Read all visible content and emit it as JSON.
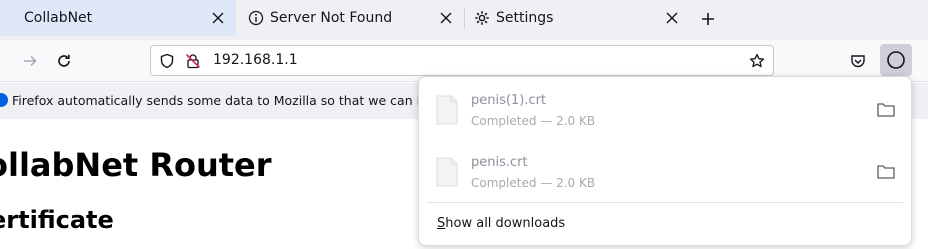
{
  "tabs": [
    {
      "label": "CollabNet",
      "active": true,
      "icon": "none"
    },
    {
      "label": "Server Not Found",
      "active": false,
      "icon": "info-icon"
    },
    {
      "label": "Settings",
      "active": false,
      "icon": "gear-icon"
    }
  ],
  "address_bar": {
    "url": "192.168.1.1"
  },
  "notification": {
    "text": "Firefox automatically sends some data to Mozilla so that we can imp"
  },
  "page": {
    "heading": "ollabNet Router",
    "subheading": "ertificate"
  },
  "downloads": {
    "items": [
      {
        "name": "penis(1).crt",
        "status": "Completed — 2.0 KB"
      },
      {
        "name": "penis.crt",
        "status": "Completed — 2.0 KB"
      }
    ],
    "show_all_prefix": "S",
    "show_all_rest": "how all downloads"
  },
  "colors": {
    "accent": "#0060df",
    "active_tab": "#dfe8f8",
    "toolbar": "#f9f9fb",
    "tabstrip": "#f0f0f4"
  }
}
